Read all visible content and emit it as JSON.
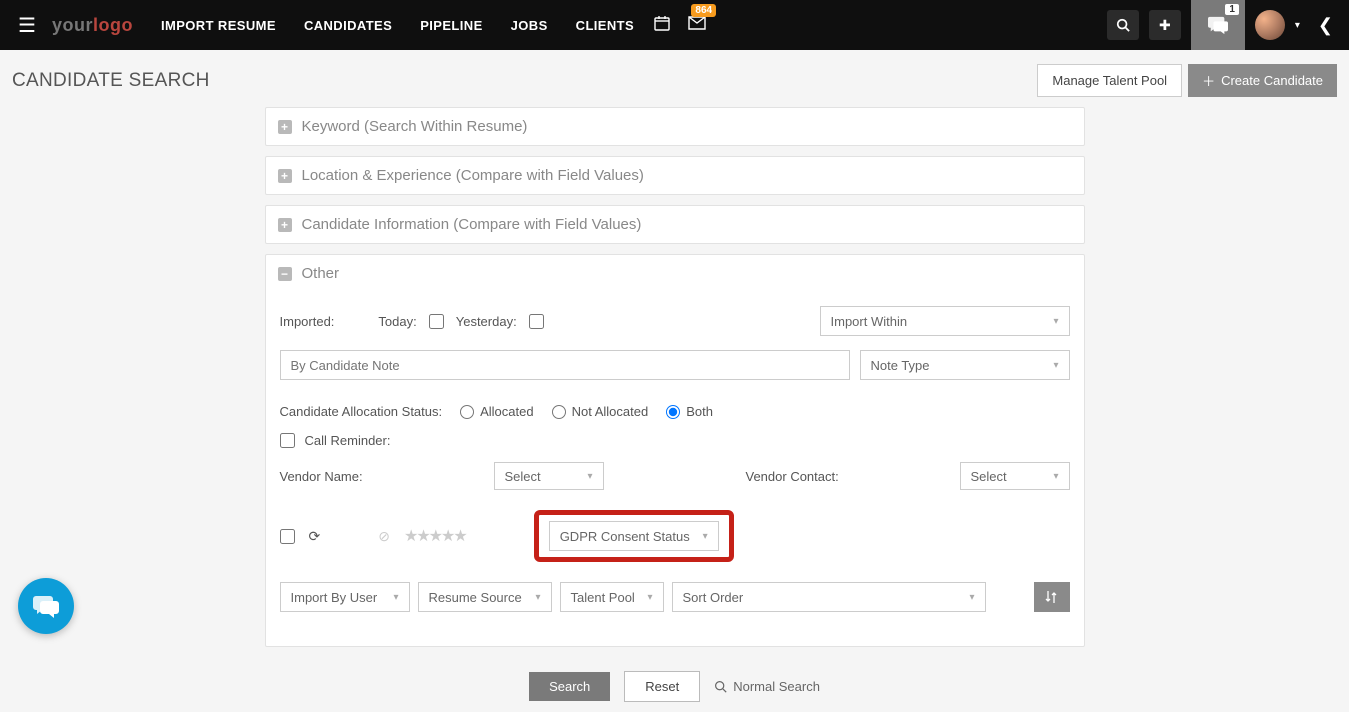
{
  "logo": {
    "part1": "your",
    "part2": "logo"
  },
  "nav": [
    "IMPORT RESUME",
    "CANDIDATES",
    "PIPELINE",
    "JOBS",
    "CLIENTS"
  ],
  "mail_badge": "864",
  "chat_badge": "1",
  "page_title": "CANDIDATE SEARCH",
  "header": {
    "manage_pool": "Manage Talent Pool",
    "create_candidate": "Create Candidate"
  },
  "panels": {
    "keyword": "Keyword (Search Within Resume)",
    "location": "Location & Experience (Compare with Field Values)",
    "candidate_info": "Candidate Information (Compare with Field Values)",
    "other": "Other"
  },
  "other": {
    "imported_label": "Imported:",
    "today_label": "Today:",
    "yesterday_label": "Yesterday:",
    "import_within": "Import Within",
    "note_placeholder": "By Candidate Note",
    "note_type": "Note Type",
    "alloc_label": "Candidate Allocation Status:",
    "alloc_allocated": "Allocated",
    "alloc_not_allocated": "Not Allocated",
    "alloc_both": "Both",
    "call_reminder": "Call Reminder:",
    "vendor_name_label": "Vendor Name:",
    "vendor_contact_label": "Vendor Contact:",
    "select_label": "Select",
    "gdpr_label": "GDPR Consent Status",
    "import_by_user": "Import By User",
    "resume_source": "Resume Source",
    "talent_pool": "Talent Pool",
    "sort_order": "Sort Order"
  },
  "footer": {
    "search": "Search",
    "reset": "Reset",
    "normal_search": "Normal Search"
  }
}
